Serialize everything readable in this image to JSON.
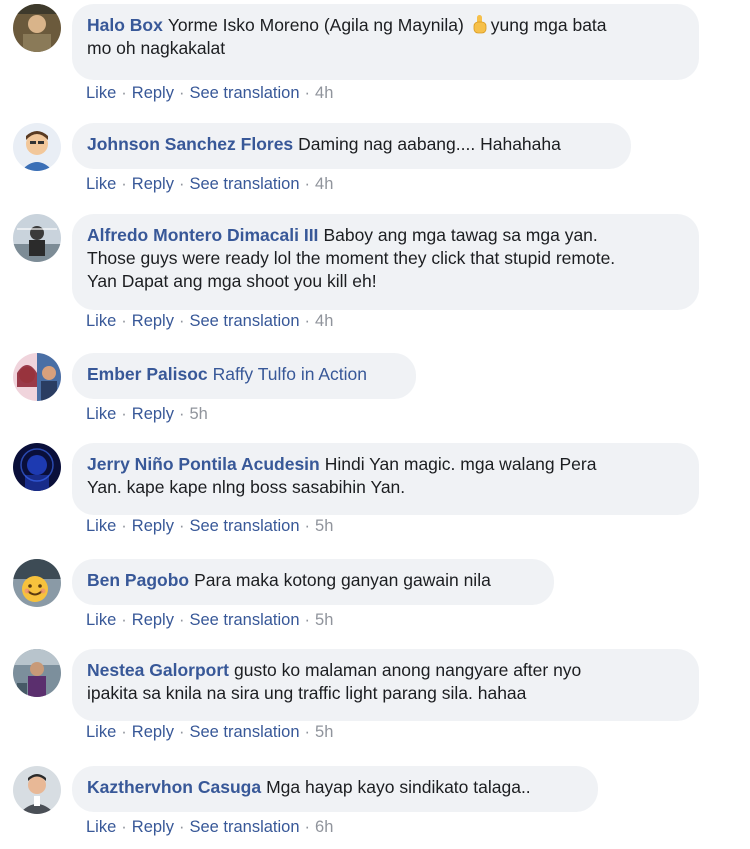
{
  "comments": [
    {
      "author": "Halo Box",
      "text": "Yorme Isko Moreno (Agila ng Maynila)",
      "text_after_emoji": "yung mga bata\nmo oh nagkakalat",
      "emoji": "pointing-up-emoji",
      "actions": {
        "like": "Like",
        "reply": "Reply",
        "translate": "See translation",
        "time": "4h"
      }
    },
    {
      "author": "Johnson Sanchez Flores",
      "text": "Daming nag aabang.... Hahahaha",
      "actions": {
        "like": "Like",
        "reply": "Reply",
        "translate": "See translation",
        "time": "4h"
      }
    },
    {
      "author": "Alfredo Montero Dimacali III",
      "text": "Baboy ang mga tawag sa mga yan.\nThose guys were ready lol the moment they click that stupid remote.\nYan Dapat ang mga shoot you kill eh!",
      "actions": {
        "like": "Like",
        "reply": "Reply",
        "translate": "See translation",
        "time": "4h"
      }
    },
    {
      "author": "Ember Palisoc",
      "text": "Raffy Tulfo in Action",
      "text_is_link": true,
      "actions": {
        "like": "Like",
        "reply": "Reply",
        "time": "5h"
      }
    },
    {
      "author": "Jerry Niño Pontila Acudesin",
      "text": "Hindi Yan magic. mga walang Pera\nYan. kape kape nlng boss sasabihin Yan.",
      "actions": {
        "like": "Like",
        "reply": "Reply",
        "translate": "See translation",
        "time": "5h"
      }
    },
    {
      "author": "Ben Pagobo",
      "text": "Para maka kotong ganyan gawain nila",
      "actions": {
        "like": "Like",
        "reply": "Reply",
        "translate": "See translation",
        "time": "5h"
      }
    },
    {
      "author": "Nestea Galorport",
      "text": "gusto ko malaman anong nangyare after nyo\nipakita sa knila na sira ung traffic light parang sila. hahaa",
      "actions": {
        "like": "Like",
        "reply": "Reply",
        "translate": "See translation",
        "time": "5h"
      }
    },
    {
      "author": "Kazthervhon Casuga",
      "text": "Mga hayap kayo sindikato talaga..",
      "actions": {
        "like": "Like",
        "reply": "Reply",
        "translate": "See translation",
        "time": "6h"
      }
    }
  ],
  "separator": "·",
  "colors": {
    "link": "#385898",
    "bubble": "#f0f2f5",
    "meta": "#90949c"
  }
}
